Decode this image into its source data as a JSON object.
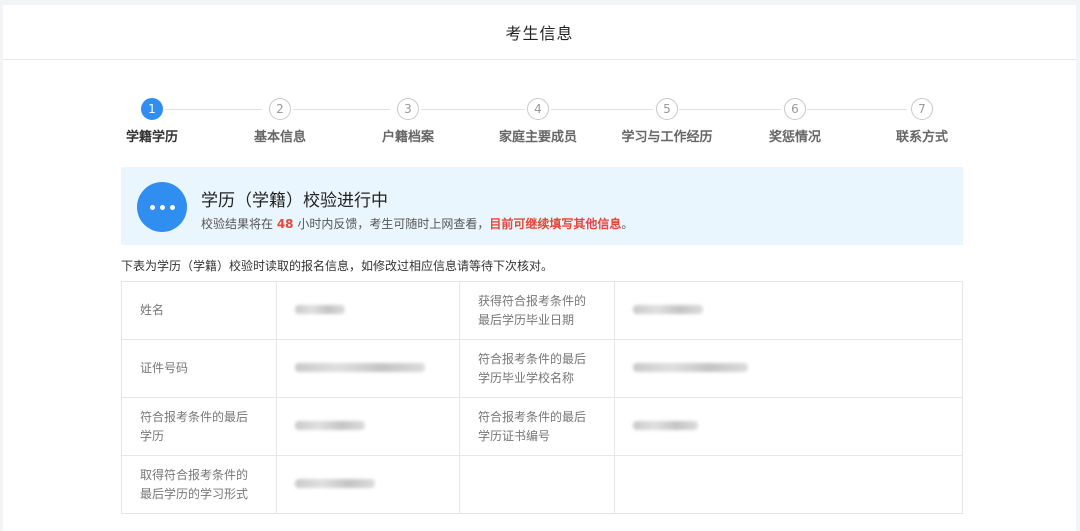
{
  "header": {
    "title": "考生信息"
  },
  "steps": [
    {
      "num": "1",
      "label": "学籍学历"
    },
    {
      "num": "2",
      "label": "基本信息"
    },
    {
      "num": "3",
      "label": "户籍档案"
    },
    {
      "num": "4",
      "label": "家庭主要成员"
    },
    {
      "num": "5",
      "label": "学习与工作经历"
    },
    {
      "num": "6",
      "label": "奖惩情况"
    },
    {
      "num": "7",
      "label": "联系方式"
    }
  ],
  "active_step": 1,
  "notice": {
    "title": "学历（学籍）校验进行中",
    "text_before": "校验结果将在 ",
    "hours": "48",
    "text_middle": " 小时内反馈，考生可随时上网查看，",
    "warning": "目前可继续填写其他信息",
    "text_end": "。",
    "accent_color": "#2f8ef0",
    "warning_color": "#e5473a"
  },
  "description": "下表为学历（学籍）校验时读取的报名信息，如修改过相应信息请等待下次核对。",
  "table": {
    "rows": [
      {
        "label1": "姓名",
        "label2": "获得符合报考条件的最后学历毕业日期"
      },
      {
        "label1": "证件号码",
        "label2": "符合报考条件的最后学历毕业学校名称"
      },
      {
        "label1": "符合报考条件的最后学历",
        "label2": "符合报考条件的最后学历证书编号"
      },
      {
        "label1": "取得符合报考条件的最后学历的学习形式",
        "label2": ""
      }
    ]
  }
}
